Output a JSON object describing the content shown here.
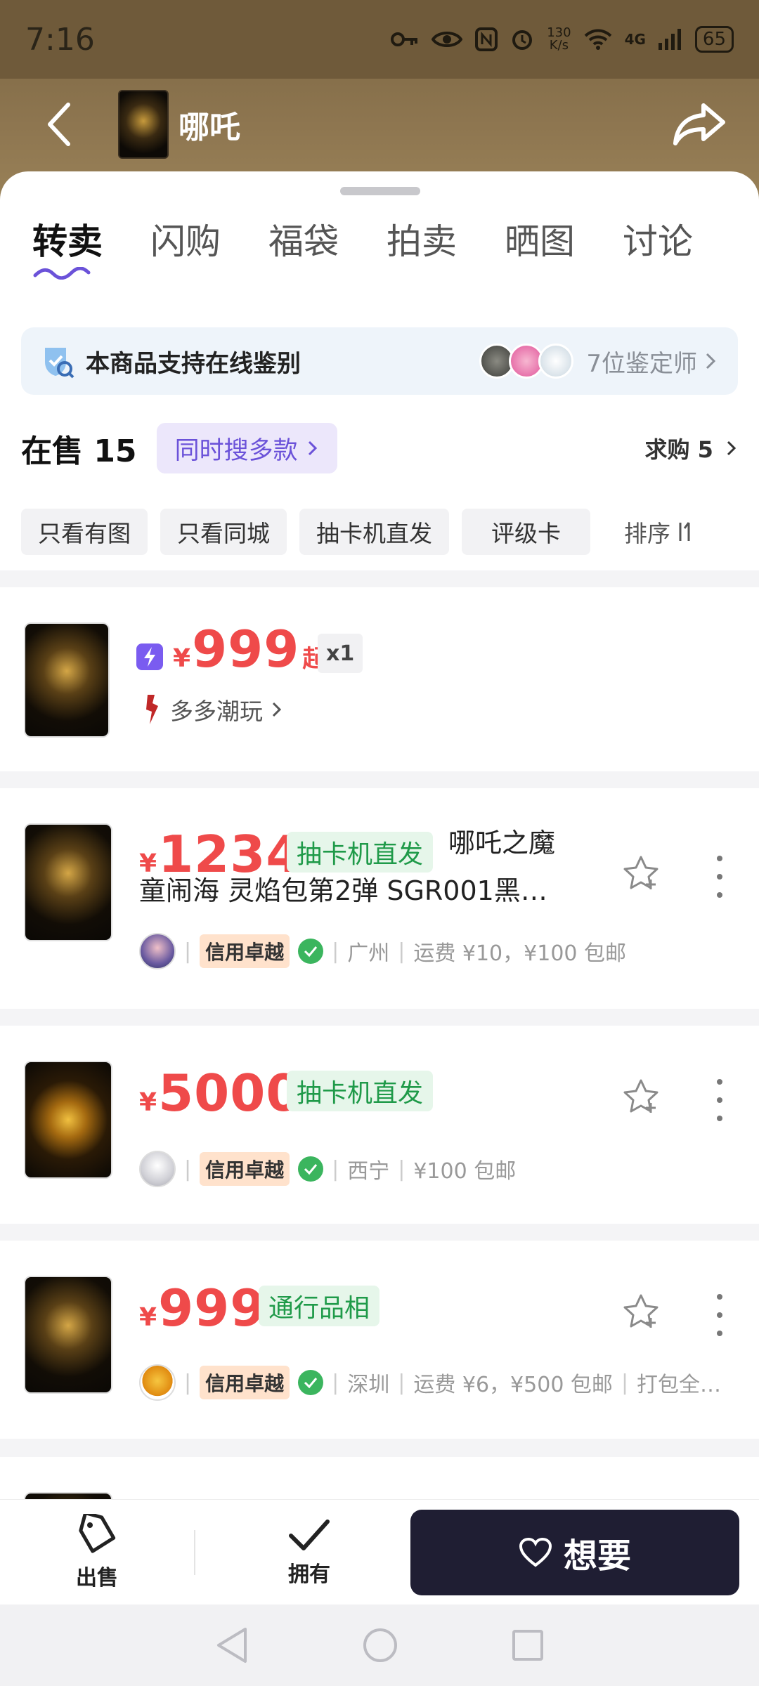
{
  "status": {
    "time": "7:16",
    "net_speed_top": "130",
    "net_speed_bottom": "K/s",
    "network": "4G",
    "battery": "65"
  },
  "header": {
    "title": "哪吒"
  },
  "tabs": [
    {
      "label": "转卖"
    },
    {
      "label": "闪购"
    },
    {
      "label": "福袋"
    },
    {
      "label": "拍卖"
    },
    {
      "label": "晒图"
    },
    {
      "label": "讨论"
    }
  ],
  "verify": {
    "text": "本商品支持在线鉴别",
    "appraisers": "7位鉴定师"
  },
  "onsale": {
    "label": "在售 15",
    "multi_search": "同时搜多款",
    "wanted": "求购 5"
  },
  "filters": [
    "只看有图",
    "只看同城",
    "抽卡机直发",
    "评级卡"
  ],
  "sort_label": "排序",
  "featured": {
    "currency": "¥",
    "price": "999",
    "suffix": "起",
    "qty": "x1",
    "seller": "多多潮玩"
  },
  "listings": [
    {
      "currency": "¥",
      "price": "1234",
      "tag": "抽卡机直发",
      "title_line1": "哪吒之魔",
      "title_line2": "童闹海 灵焰包第2弹 SGR001黑…",
      "credit": "信用卓越",
      "location": "广州",
      "shipping": "运费 ¥10，¥100 包邮"
    },
    {
      "currency": "¥",
      "price": "5000",
      "tag": "抽卡机直发",
      "credit": "信用卓越",
      "location": "西宁",
      "shipping": "¥100 包邮"
    },
    {
      "currency": "¥",
      "price": "999",
      "tag": "通行品相",
      "credit": "信用卓越",
      "location": "深圳",
      "shipping": "运费 ¥6，¥500 包邮",
      "extra": "打包全…"
    }
  ],
  "bottom": {
    "sell": "出售",
    "own": "拥有",
    "want": "想要"
  },
  "colors": {
    "price_red": "#ef4a4a",
    "accent_purple": "#6b52d9",
    "green_tag": "#1f9a49",
    "want_button": "#1f1e33"
  }
}
